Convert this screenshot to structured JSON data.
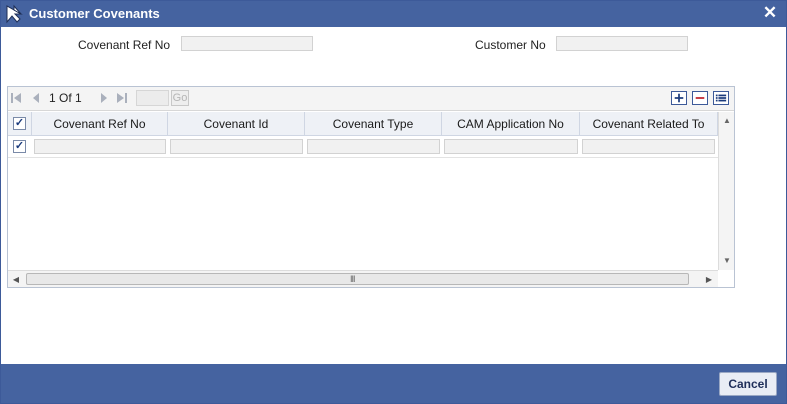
{
  "window": {
    "title": "Customer Covenants",
    "close_glyph": "✕",
    "title_bar_color": "#4563a0",
    "logo_icon": "app-logo-icon"
  },
  "header": {
    "covenant_ref_label": "Covenant Ref No",
    "covenant_ref_value": "",
    "customer_no_label": "Customer No",
    "customer_no_value": ""
  },
  "pager": {
    "current_page": "1",
    "of_label": "Of",
    "total_pages": "1",
    "go_label": "Go",
    "page_input_value": "",
    "first_icon": "first-page-icon",
    "prev_icon": "prev-page-icon",
    "next_icon": "next-page-icon",
    "last_icon": "last-page-icon",
    "add_row_icon": "add-row-icon",
    "delete_row_icon": "delete-row-icon",
    "single_view_icon": "single-record-view-icon"
  },
  "grid": {
    "columns": [
      "Covenant Ref No",
      "Covenant Id",
      "Covenant Type",
      "CAM Application No",
      "Covenant Related To"
    ],
    "rows": [
      {
        "checked": true,
        "values": [
          "",
          "",
          "",
          "",
          ""
        ]
      }
    ],
    "header_checked": true
  },
  "scrollbar": {
    "grip_glyph": "III"
  },
  "footer": {
    "cancel_label": "Cancel"
  }
}
